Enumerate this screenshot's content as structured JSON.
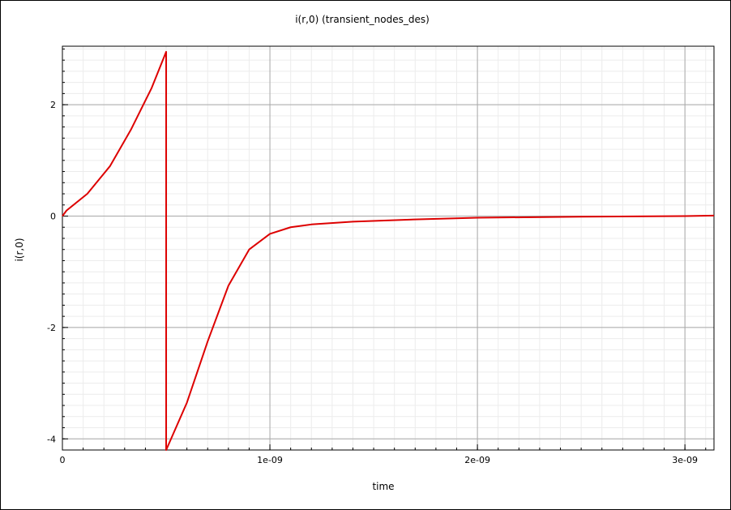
{
  "chart_data": {
    "type": "line",
    "title": "i(r,0) (transient_nodes_des)",
    "xlabel": "time",
    "ylabel": "i(r,0)",
    "xlim": [
      0,
      3.14e-09
    ],
    "ylim": [
      -4.2,
      3.05
    ],
    "grid": true,
    "x_ticks": [
      {
        "value": 0,
        "label": "0"
      },
      {
        "value": 1e-09,
        "label": "1e-09"
      },
      {
        "value": 2e-09,
        "label": "2e-09"
      },
      {
        "value": 3e-09,
        "label": "3e-09"
      }
    ],
    "y_ticks": [
      {
        "value": 2,
        "label": "2"
      },
      {
        "value": 0,
        "label": "0"
      },
      {
        "value": -2,
        "label": "-2"
      },
      {
        "value": -4,
        "label": "-4"
      }
    ],
    "series": [
      {
        "color": "#dd0000",
        "x": [
          0,
          2e-11,
          1.2e-10,
          2.3e-10,
          3.3e-10,
          4.3e-10,
          5e-10,
          5e-10,
          6e-10,
          7e-10,
          8e-10,
          9e-10,
          1e-09,
          1.1e-09,
          1.2e-09,
          1.4e-09,
          1.7e-09,
          2e-09,
          2.5e-09,
          3e-09,
          3.14e-09
        ],
        "y": [
          0,
          0.1,
          0.4,
          0.9,
          1.55,
          2.3,
          2.95,
          -4.2,
          -3.35,
          -2.25,
          -1.25,
          -0.6,
          -0.32,
          -0.2,
          -0.15,
          -0.1,
          -0.06,
          -0.03,
          -0.01,
          0,
          0.01
        ]
      }
    ]
  }
}
